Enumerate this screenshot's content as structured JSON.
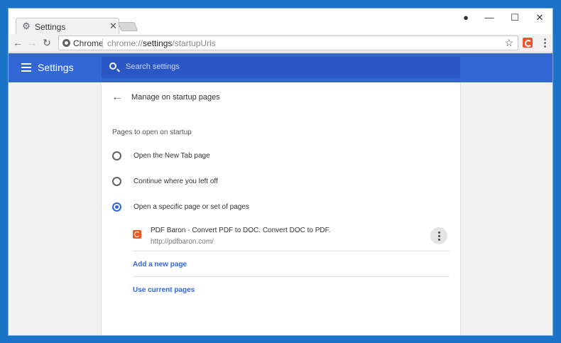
{
  "tab": {
    "title": "Settings"
  },
  "toolbar": {
    "site_name": "Chrome",
    "url_prefix": "chrome://",
    "url_host": "settings",
    "url_path": "/startupUrls"
  },
  "header": {
    "title": "Settings",
    "search_placeholder": "Search settings"
  },
  "startup": {
    "heading": "Manage on startup pages",
    "section_label": "Pages to open on startup",
    "options": [
      {
        "label": "Open the New Tab page",
        "checked": false
      },
      {
        "label": "Continue where you left off",
        "checked": false
      },
      {
        "label": "Open a specific page or set of pages",
        "checked": true
      }
    ],
    "pages": [
      {
        "title": "PDF Baron - Convert PDF to DOC. Convert DOC to PDF.",
        "url": "http://pdfbaron.com/"
      }
    ],
    "add_page_label": "Add a new page",
    "use_current_label": "Use current pages"
  },
  "colors": {
    "accent": "#3367d6",
    "extension": "#e8562a"
  }
}
